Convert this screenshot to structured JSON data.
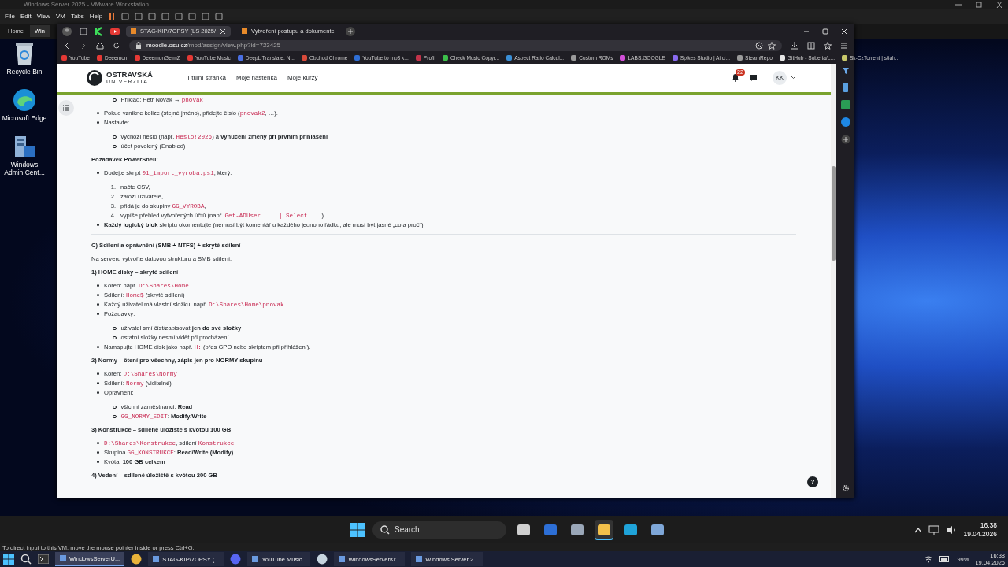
{
  "vmware": {
    "title": "Windows Server 2025 - VMware Workstation",
    "menu": [
      "File",
      "Edit",
      "View",
      "VM",
      "Tabs",
      "Help"
    ],
    "tabs": [
      {
        "label": "Home",
        "selected": false
      },
      {
        "label": "Win",
        "selected": true
      }
    ],
    "status": "To direct input to this VM, move the mouse pointer inside or press Ctrl+G."
  },
  "desktop_icons": [
    {
      "kind": "bin",
      "label": "Recycle Bin"
    },
    {
      "kind": "edge",
      "label": "Microsoft Edge"
    },
    {
      "kind": "server",
      "label": "Windows Admin Cent..."
    }
  ],
  "browser": {
    "tabs": [
      {
        "label": "STAG-KIP/7OPSY (LS 2025/",
        "selected": true
      },
      {
        "label": "Vytvoření postupu a dokumente",
        "selected": false
      }
    ],
    "url_host": "moodle.osu.cz",
    "url_path": "/mod/assign/view.php?id=723425",
    "bookmarks": [
      {
        "label": "YouTube",
        "color": "#e53935"
      },
      {
        "label": "Deeemon",
        "color": "#e53935"
      },
      {
        "label": "DeeemonGejmZ",
        "color": "#e53935"
      },
      {
        "label": "YouTube Music",
        "color": "#e53935"
      },
      {
        "label": "DeepL Translate: N...",
        "color": "#4a6fe3"
      },
      {
        "label": "Obchod Chrome",
        "color": "#d84a3a"
      },
      {
        "label": "YouTube to mp3 k...",
        "color": "#2f6fd6"
      },
      {
        "label": "Profil",
        "color": "#c2334a"
      },
      {
        "label": "Check Music Copyr...",
        "color": "#3cbf4a"
      },
      {
        "label": "Aspect Ratio Calcul...",
        "color": "#3a8fd6"
      },
      {
        "label": "Custom ROMs",
        "color": "#9a9a9a"
      },
      {
        "label": "LABS.GOOGLE",
        "color": "#d24fd8"
      },
      {
        "label": "Spikes Studio | Ai cl...",
        "color": "#8a6bf0"
      },
      {
        "label": "SteamRepo",
        "color": "#9a9a9a"
      },
      {
        "label": "GitHub - Soberia/L...",
        "color": "#e6e6e6"
      },
      {
        "label": "Sk-CzTorrent | stiah...",
        "color": "#c8c86a"
      }
    ]
  },
  "site": {
    "logo_top": "OSTRAVSKÁ",
    "logo_bottom": "UNIVERZITA",
    "nav": [
      "Titulní stránka",
      "Moje nástěnka",
      "Moje kurzy"
    ],
    "notifications": "22",
    "user": "KK",
    "help": "?"
  },
  "content": [
    {
      "kind": "circles",
      "items": [
        {
          "parts": [
            {
              "kind": "text",
              "text": "Příklad: Petr Novák → "
            },
            {
              "kind": "code",
              "text": "pnovak"
            }
          ]
        }
      ]
    },
    {
      "kind": "bullets",
      "items": [
        {
          "parts": [
            {
              "kind": "text",
              "text": "Pokud vznikne kolize (stejné jméno), přidejte číslo ("
            },
            {
              "kind": "code",
              "text": "pnovak2"
            },
            {
              "kind": "text",
              "text": ", …)."
            }
          ]
        },
        {
          "parts": [
            {
              "kind": "text",
              "text": "Nastavte:"
            }
          ],
          "children": {
            "kind": "circles",
            "items": [
              {
                "parts": [
                  {
                    "kind": "text",
                    "text": "výchozí heslo (např. "
                  },
                  {
                    "kind": "code",
                    "text": "Heslo!2026"
                  },
                  {
                    "kind": "text",
                    "text": ") a "
                  },
                  {
                    "kind": "bold",
                    "text": "vynucení změny při prvním přihlášení"
                  }
                ]
              },
              {
                "parts": [
                  {
                    "kind": "text",
                    "text": "účet povolený (Enabled)"
                  }
                ]
              }
            ]
          }
        }
      ]
    },
    {
      "kind": "heading",
      "text": "Požadavek PowerShell:"
    },
    {
      "kind": "bullets",
      "items": [
        {
          "parts": [
            {
              "kind": "text",
              "text": "Dodejte skript "
            },
            {
              "kind": "code",
              "text": "01_import_vyroba.ps1"
            },
            {
              "kind": "text",
              "text": ", který:"
            }
          ],
          "children": {
            "kind": "numbers",
            "items": [
              {
                "marker": "1.",
                "parts": [
                  {
                    "kind": "text",
                    "text": "načte CSV,"
                  }
                ]
              },
              {
                "marker": "2.",
                "parts": [
                  {
                    "kind": "text",
                    "text": "založí uživatele,"
                  }
                ]
              },
              {
                "marker": "3.",
                "parts": [
                  {
                    "kind": "text",
                    "text": "přidá je do skupiny "
                  },
                  {
                    "kind": "code",
                    "text": "GG_VYROBA"
                  },
                  {
                    "kind": "text",
                    "text": ","
                  }
                ]
              },
              {
                "marker": "4.",
                "parts": [
                  {
                    "kind": "text",
                    "text": "vypíše přehled vytvořených účtů (např. "
                  },
                  {
                    "kind": "code",
                    "text": "Get-ADUser ... | Select ..."
                  },
                  {
                    "kind": "text",
                    "text": ")."
                  }
                ]
              }
            ]
          }
        },
        {
          "parts": [
            {
              "kind": "bold",
              "text": "Každý logický blok"
            },
            {
              "kind": "text",
              "text": " skriptu okomentujte (nemusí být komentář u každého jednoho řádku, ale musí být jasné „co a proč“)."
            }
          ]
        }
      ]
    },
    {
      "kind": "rule"
    },
    {
      "kind": "heading",
      "text": "C) Sdílení a oprávnění (SMB + NTFS) + skryté sdílení"
    },
    {
      "kind": "paragraph",
      "text": "Na serveru vytvořte datovou strukturu a SMB sdílení:"
    },
    {
      "kind": "heading",
      "text": "1) HOME disky – skryté sdílení"
    },
    {
      "kind": "bullets",
      "items": [
        {
          "parts": [
            {
              "kind": "text",
              "text": "Kořen: např. "
            },
            {
              "kind": "code",
              "text": "D:\\Shares\\Home"
            }
          ]
        },
        {
          "parts": [
            {
              "kind": "text",
              "text": "Sdílení: "
            },
            {
              "kind": "code",
              "text": "Home$"
            },
            {
              "kind": "text",
              "text": " (skryté sdílení)"
            }
          ]
        },
        {
          "parts": [
            {
              "kind": "text",
              "text": "Každý uživatel má vlastní složku, např. "
            },
            {
              "kind": "code",
              "text": "D:\\Shares\\Home\\pnovak"
            }
          ]
        },
        {
          "parts": [
            {
              "kind": "text",
              "text": "Požadavky:"
            }
          ],
          "children": {
            "kind": "circles",
            "items": [
              {
                "parts": [
                  {
                    "kind": "text",
                    "text": "uživatel smí číst/zapisovat "
                  },
                  {
                    "kind": "bold",
                    "text": "jen do své složky"
                  }
                ]
              },
              {
                "parts": [
                  {
                    "kind": "text",
                    "text": "ostatní složky nesmí vidět při procházení"
                  }
                ]
              }
            ]
          }
        },
        {
          "parts": [
            {
              "kind": "text",
              "text": "Namapujte HOME disk jako např. "
            },
            {
              "kind": "code",
              "text": "H:"
            },
            {
              "kind": "text",
              "text": " (přes GPO nebo skriptem při přihlášení)."
            }
          ]
        }
      ]
    },
    {
      "kind": "heading",
      "text": "2) Normy – čtení pro všechny, zápis jen pro NORMY skupinu"
    },
    {
      "kind": "bullets",
      "items": [
        {
          "parts": [
            {
              "kind": "text",
              "text": "Kořen: "
            },
            {
              "kind": "code",
              "text": "D:\\Shares\\Normy"
            }
          ]
        },
        {
          "parts": [
            {
              "kind": "text",
              "text": "Sdílení: "
            },
            {
              "kind": "code",
              "text": "Normy"
            },
            {
              "kind": "text",
              "text": " (viditelné)"
            }
          ]
        },
        {
          "parts": [
            {
              "kind": "text",
              "text": "Oprávnění:"
            }
          ],
          "children": {
            "kind": "circles",
            "items": [
              {
                "parts": [
                  {
                    "kind": "text",
                    "text": "všichni zaměstnanci: "
                  },
                  {
                    "kind": "bold",
                    "text": "Read"
                  }
                ]
              },
              {
                "parts": [
                  {
                    "kind": "code",
                    "text": "GG_NORMY_EDIT"
                  },
                  {
                    "kind": "text",
                    "text": ": "
                  },
                  {
                    "kind": "bold",
                    "text": "Modify/Write"
                  }
                ]
              }
            ]
          }
        }
      ]
    },
    {
      "kind": "heading",
      "text": "3) Konstrukce – sdílené úložiště s kvótou 100 GB"
    },
    {
      "kind": "bullets",
      "items": [
        {
          "parts": [
            {
              "kind": "code",
              "text": "D:\\Shares\\Konstrukce"
            },
            {
              "kind": "text",
              "text": ", sdílení "
            },
            {
              "kind": "code",
              "text": "Konstrukce"
            }
          ]
        },
        {
          "parts": [
            {
              "kind": "text",
              "text": "Skupina "
            },
            {
              "kind": "code",
              "text": "GG_KONSTRUKCE"
            },
            {
              "kind": "text",
              "text": ": "
            },
            {
              "kind": "bold",
              "text": "Read/Write (Modify)"
            }
          ]
        },
        {
          "parts": [
            {
              "kind": "text",
              "text": "Kvóta: "
            },
            {
              "kind": "bold",
              "text": "100 GB celkem"
            }
          ]
        }
      ]
    },
    {
      "kind": "heading",
      "text": "4) Vedení – sdílené úložiště s kvótou 200 GB"
    }
  ],
  "guest_taskbar": {
    "search_placeholder": "Search",
    "apps": [
      {
        "kind": "taskview",
        "selected": false
      },
      {
        "kind": "terminal",
        "selected": false
      },
      {
        "kind": "settings",
        "selected": false
      },
      {
        "kind": "folder",
        "selected": true
      },
      {
        "kind": "edge",
        "selected": false
      },
      {
        "kind": "server",
        "selected": false
      }
    ],
    "time": "16:38",
    "date": "19.04.2026"
  },
  "host_taskbar": {
    "items": [
      {
        "kind": "app",
        "label": "WindowsServerU...",
        "selected": true
      },
      {
        "kind": "chrome"
      },
      {
        "kind": "app",
        "label": "STAG-KIP/7OPSY (...",
        "selected": false
      },
      {
        "kind": "discord"
      },
      {
        "kind": "app",
        "label": "YouTube Music",
        "selected": false
      },
      {
        "kind": "steam"
      },
      {
        "kind": "app",
        "label": "WindowsServerKr...",
        "selected": false
      },
      {
        "kind": "app",
        "label": "Windows Server 2...",
        "selected": false
      }
    ],
    "battery": "99%",
    "time": "16:38",
    "date": "19.04.2026"
  }
}
